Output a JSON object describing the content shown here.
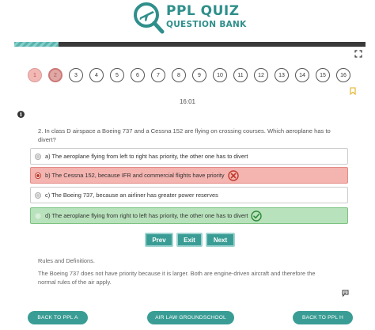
{
  "logo": {
    "title": "PPL QUIZ",
    "subtitle": "QUESTION BANK",
    "icon": "plane-magnifier-icon",
    "color": "#2f8f8b"
  },
  "progress": {
    "fraction": 0.125,
    "color": "#5ab3ad"
  },
  "question_numbers": [
    {
      "label": "1",
      "state": "answered"
    },
    {
      "label": "2",
      "state": "current"
    },
    {
      "label": "3",
      "state": "open"
    },
    {
      "label": "4",
      "state": "open"
    },
    {
      "label": "5",
      "state": "open"
    },
    {
      "label": "6",
      "state": "open"
    },
    {
      "label": "7",
      "state": "open"
    },
    {
      "label": "8",
      "state": "open"
    },
    {
      "label": "9",
      "state": "open"
    },
    {
      "label": "10",
      "state": "open"
    },
    {
      "label": "11",
      "state": "open"
    },
    {
      "label": "12",
      "state": "open"
    },
    {
      "label": "13",
      "state": "open"
    },
    {
      "label": "14",
      "state": "open"
    },
    {
      "label": "15",
      "state": "open"
    },
    {
      "label": "16",
      "state": "open"
    }
  ],
  "timer": "16:01",
  "question": {
    "text": "2. In class D airspace a Boeing 737 and a Cessna 152 are flying on crossing courses. Which aeroplane has to divert?"
  },
  "answers": [
    {
      "label": "a) The aeroplane flying from left to right has priority, the other one has to divert",
      "state": "neutral"
    },
    {
      "label": "b) The Cessna 152, because IFR and commercial flights have priority",
      "state": "wrong"
    },
    {
      "label": "c) The Boeing 737, because an airliner has greater power reserves",
      "state": "neutral"
    },
    {
      "label": "d) The aeroplane flying from right to left has priority, the other one has to divert",
      "state": "correct"
    }
  ],
  "nav": {
    "prev": "Prev",
    "exit": "Exit",
    "next": "Next"
  },
  "explanation": {
    "title": "Rules and Definitions.",
    "text": "The Boeing 737 does not have priority because it is larger. Both are engine-driven aircraft and therefore the normal rules of the air apply."
  },
  "bottom": {
    "back_ppl_a": "BACK TO PPL A",
    "groundschool": "AIR LAW GROUNDSCHOOL",
    "back_ppl_h": "BACK TO PPL H"
  },
  "colors": {
    "accent": "#3a9d95",
    "wrong": "#f4b4b0",
    "correct": "#b8e2bb"
  }
}
